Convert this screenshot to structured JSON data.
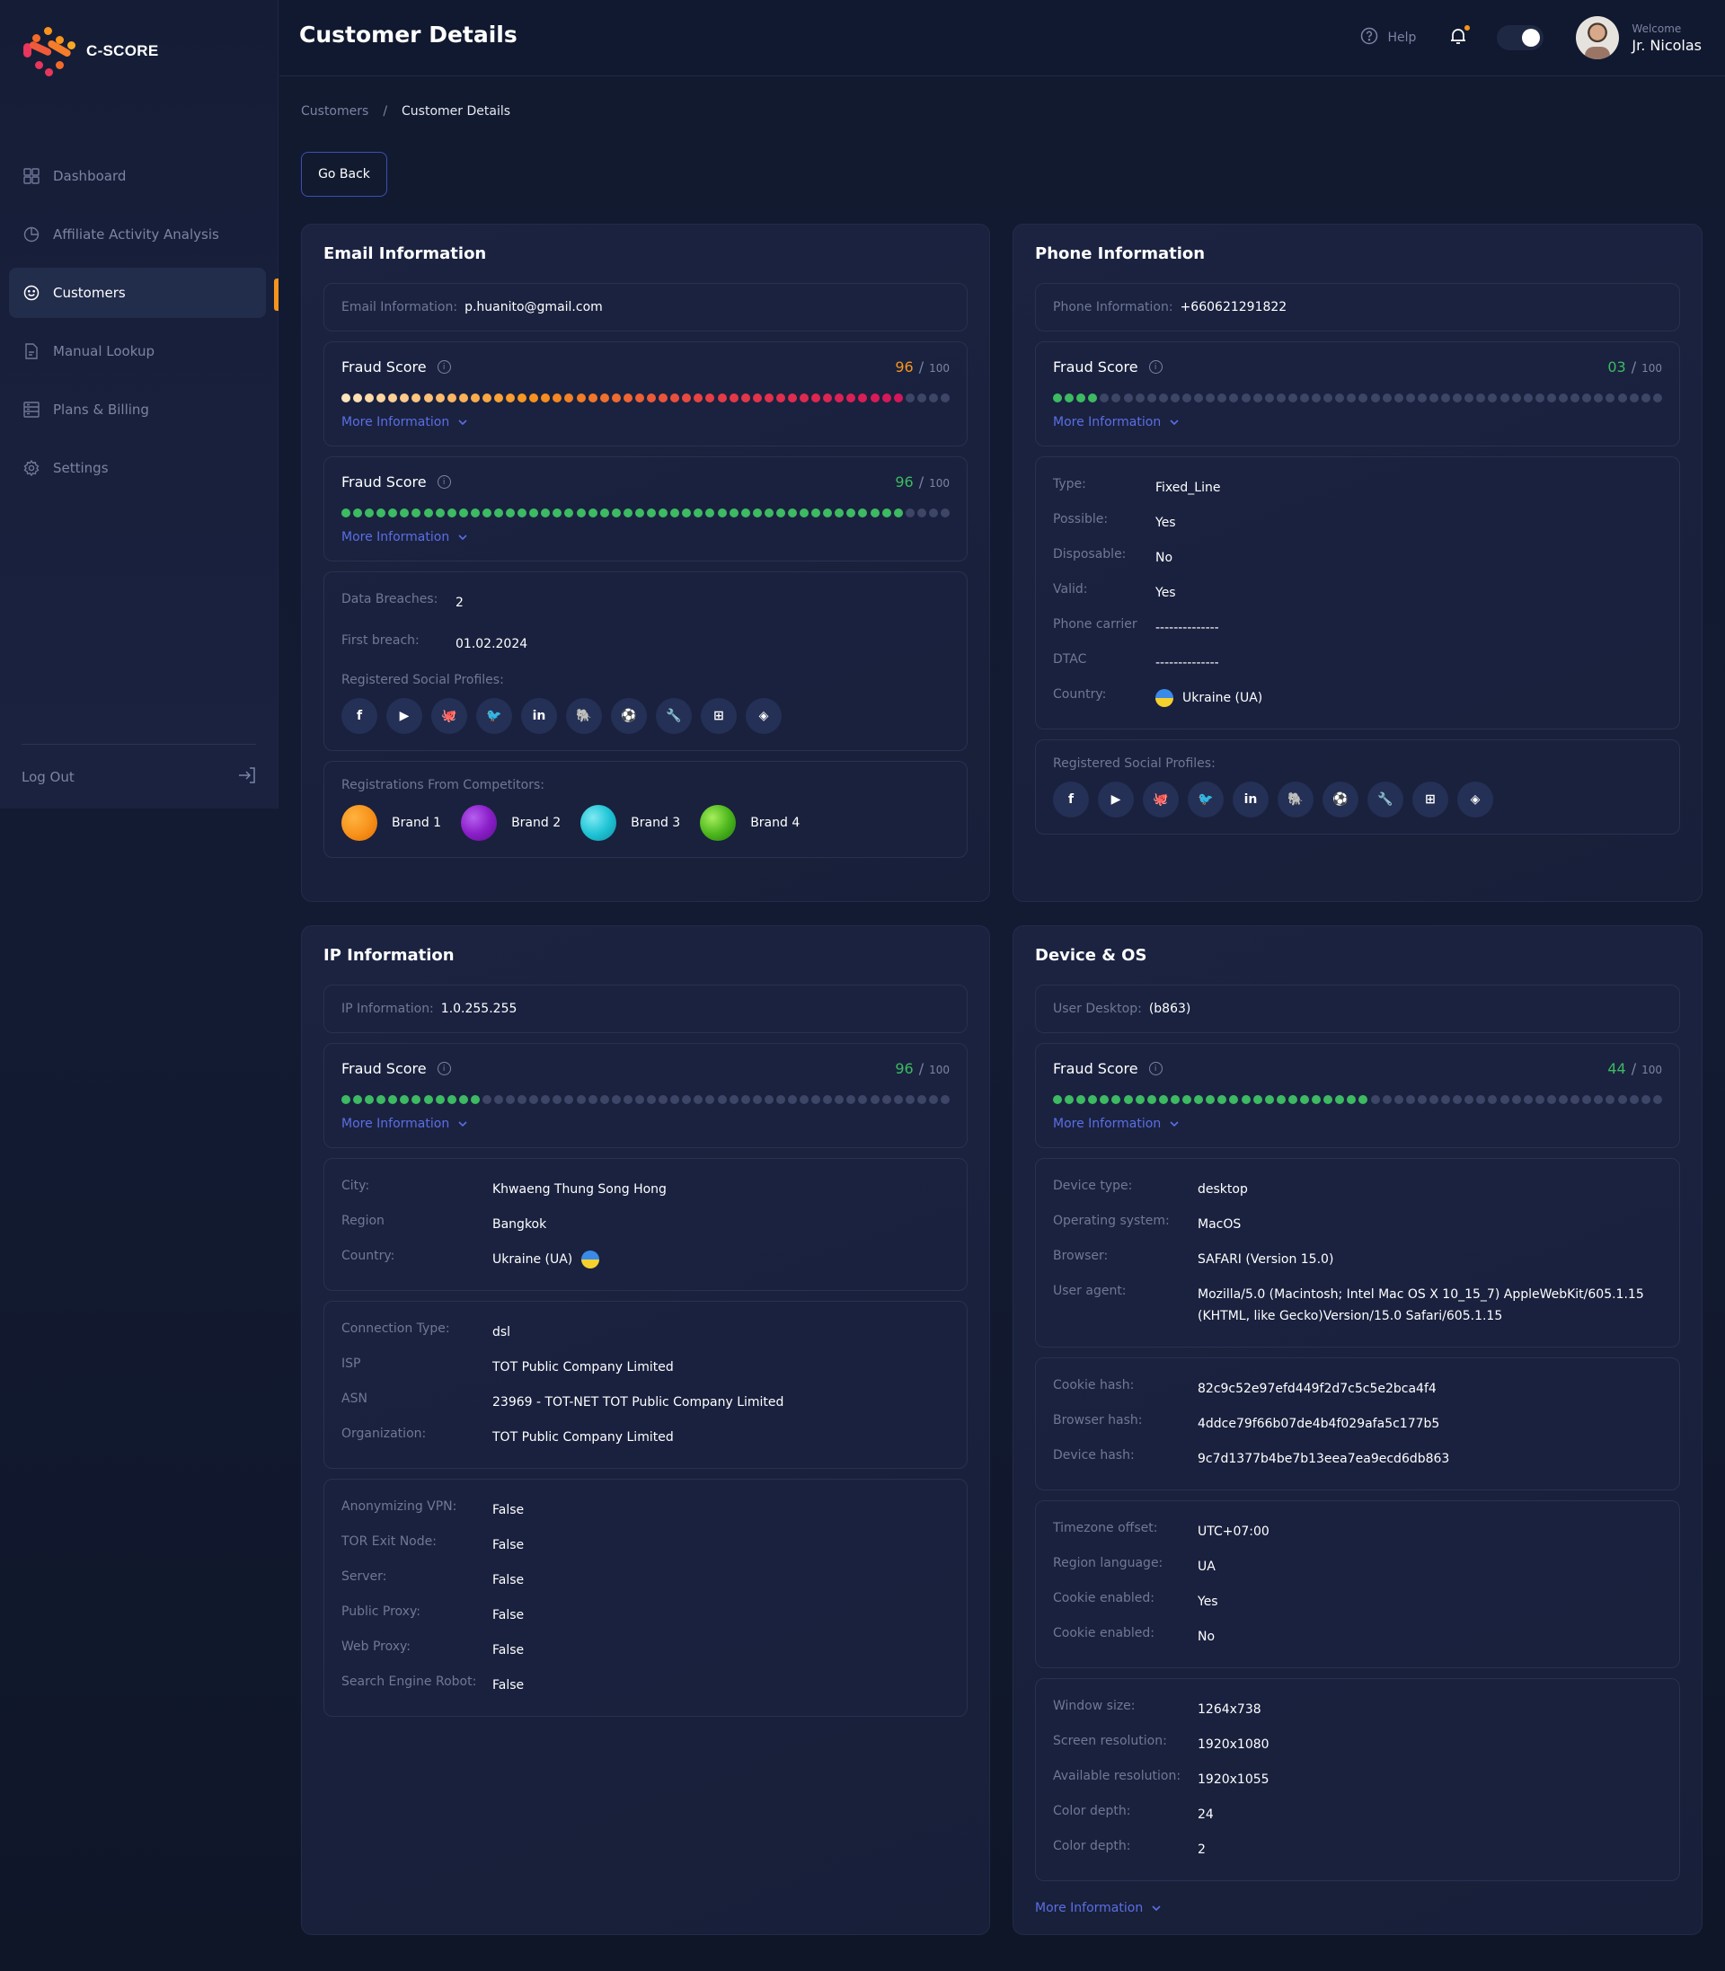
{
  "brand": {
    "name": "C-SCORE"
  },
  "colors": {
    "accent": "#f7941d",
    "link": "#5b6ee4",
    "green": "#3dba62",
    "dot_inactive": "#3d4666"
  },
  "header": {
    "title": "Customer Details",
    "help_label": "Help",
    "welcome_label": "Welcome",
    "user_name": "Jr. Nicolas"
  },
  "sidebar": {
    "items": [
      {
        "label": "Dashboard",
        "icon": "grid-icon"
      },
      {
        "label": "Affiliate Activity Analysis",
        "icon": "pie-chart-icon"
      },
      {
        "label": "Customers",
        "icon": "smile-icon",
        "active": true
      },
      {
        "label": "Manual Lookup",
        "icon": "document-icon"
      },
      {
        "label": "Plans & Billing",
        "icon": "billing-icon"
      },
      {
        "label": "Settings",
        "icon": "gear-icon"
      }
    ],
    "logout_label": "Log Out"
  },
  "breadcrumb": {
    "parent": "Customers",
    "separator": "/",
    "current": "Customer Details"
  },
  "go_back_label": "Go Back",
  "fraud_score_label": "Fraud Score",
  "more_info_label": "More Information",
  "score_max": "100",
  "score_sep": "/",
  "email": {
    "title": "Email Information",
    "info_label": "Email Information:",
    "info_value": "p.huanito@gmail.com",
    "scores": [
      {
        "value": "96",
        "fraction": 0.93,
        "style": "gradient",
        "color": "#f7941d"
      },
      {
        "value": "96",
        "fraction": 0.93,
        "style": "green",
        "color": "#3dba62"
      }
    ],
    "breaches_label": "Data Breaches:",
    "breaches_value": "2",
    "first_breach_label": "First breach:",
    "first_breach_value": "01.02.2024",
    "socials_label": "Registered Social Profiles:",
    "socials": [
      "f",
      "▶",
      "🐙",
      "🐦",
      "in",
      "🐘",
      "⚽",
      "🔧",
      "⊞",
      "◈"
    ],
    "competitors_label": "Registrations From Competitors:",
    "competitors": [
      {
        "name": "Brand 1",
        "color": "#f7941d"
      },
      {
        "name": "Brand 2",
        "color": "#8b1fc9"
      },
      {
        "name": "Brand 3",
        "color": "#20c5d6"
      },
      {
        "name": "Brand 4",
        "color": "#4fb81e"
      }
    ]
  },
  "phone": {
    "title": "Phone Information",
    "info_label": "Phone Information:",
    "info_value": "+660621291822",
    "score": {
      "value": "03",
      "fraction": 0.08,
      "color": "#3dba62"
    },
    "fields": [
      {
        "k": "Type:",
        "v": "Fixed_Line"
      },
      {
        "k": "Possible:",
        "v": "Yes"
      },
      {
        "k": "Disposable:",
        "v": "No"
      },
      {
        "k": "Valid:",
        "v": "Yes"
      },
      {
        "k": "Phone carrier",
        "v": "--------------"
      },
      {
        "k": "DTAC",
        "v": "--------------"
      },
      {
        "k": "Country:",
        "v": "Ukraine (UA)"
      }
    ],
    "socials_label": "Registered Social Profiles:"
  },
  "ip": {
    "title": "IP Information",
    "info_label": "IP Information:",
    "info_value": "1.0.255.255",
    "score": {
      "value": "96",
      "fraction": 0.23,
      "color": "#3dba62"
    },
    "location": [
      {
        "k": "City:",
        "v": "Khwaeng Thung Song Hong"
      },
      {
        "k": "Region",
        "v": "Bangkok"
      },
      {
        "k": "Country:",
        "v": "Ukraine (UA)"
      }
    ],
    "connection": [
      {
        "k": "Connection Type:",
        "v": "dsl"
      },
      {
        "k": "ISP",
        "v": "TOT Public Company Limited"
      },
      {
        "k": "ASN",
        "v": "23969 - TOT-NET TOT Public Company Limited"
      },
      {
        "k": "Organization:",
        "v": "TOT Public Company Limited"
      }
    ],
    "flags": [
      {
        "k": "Anonymizing VPN:",
        "v": "False"
      },
      {
        "k": "TOR Exit Node:",
        "v": "False"
      },
      {
        "k": "Server:",
        "v": "False"
      },
      {
        "k": "Public Proxy:",
        "v": "False"
      },
      {
        "k": "Web Proxy:",
        "v": "False"
      },
      {
        "k": "Search Engine Robot:",
        "v": "False"
      }
    ]
  },
  "device": {
    "title": "Device & OS",
    "info_label": "User Desktop:",
    "info_value": "(b863)",
    "score": {
      "value": "44",
      "fraction": 0.52,
      "color": "#3dba62"
    },
    "system": [
      {
        "k": "Device type:",
        "v": "desktop"
      },
      {
        "k": "Operating system:",
        "v": "MacOS"
      },
      {
        "k": "Browser:",
        "v": "SAFARI (Version 15.0)"
      },
      {
        "k": "User agent:",
        "v": "Mozilla/5.0 (Macintosh; Intel Mac OS X 10_15_7) AppleWebKit/605.1.15 (KHTML, like Gecko)Version/15.0 Safari/605.1.15"
      }
    ],
    "hashes": [
      {
        "k": "Cookie hash:",
        "v": "82c9c52e97efd449f2d7c5c5e2bca4f4"
      },
      {
        "k": "Browser hash:",
        "v": "4ddce79f66b07de4b4f029afa5c177b5"
      },
      {
        "k": "Device hash:",
        "v": "9c7d1377b4be7b13eea7ea9ecd6db863"
      }
    ],
    "locale": [
      {
        "k": "Timezone offset:",
        "v": "UTC+07:00"
      },
      {
        "k": "Region language:",
        "v": "UA"
      },
      {
        "k": "Cookie enabled:",
        "v": "Yes"
      },
      {
        "k": "Cookie enabled:",
        "v": "No"
      }
    ],
    "screen": [
      {
        "k": "Window size:",
        "v": "1264x738"
      },
      {
        "k": "Screen resolution:",
        "v": "1920x1080"
      },
      {
        "k": "Available resolution:",
        "v": "1920x1055"
      },
      {
        "k": "Color depth:",
        "v": "24"
      },
      {
        "k": "Color depth:",
        "v": "2"
      }
    ]
  }
}
